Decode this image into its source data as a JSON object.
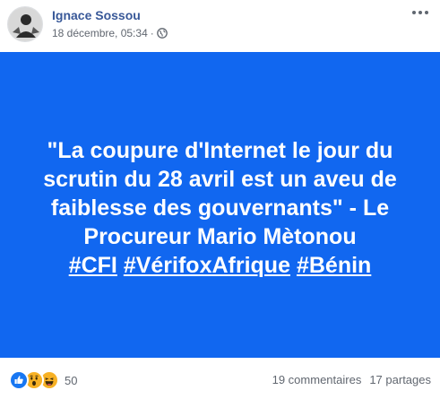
{
  "post": {
    "author": "Ignace Sossou",
    "timestamp": "18 décembre, 05:34",
    "separator": "·",
    "privacy_icon": "globe-icon",
    "more_icon": "more-options-icon"
  },
  "card": {
    "background_color": "#1167f0",
    "quote": "\"La coupure d'Internet le jour du scrutin du 28 avril est un aveu de faiblesse des gouvernants\" - Le Procureur Mario Mètonou",
    "hashtags": [
      "#CFI",
      "#VérifoxAfrique",
      "#Bénin"
    ]
  },
  "footer": {
    "reaction_icons": [
      "like-icon",
      "wow-icon",
      "haha-icon"
    ],
    "reaction_count": "50",
    "comments": "19 commentaires",
    "shares": "17 partages"
  }
}
